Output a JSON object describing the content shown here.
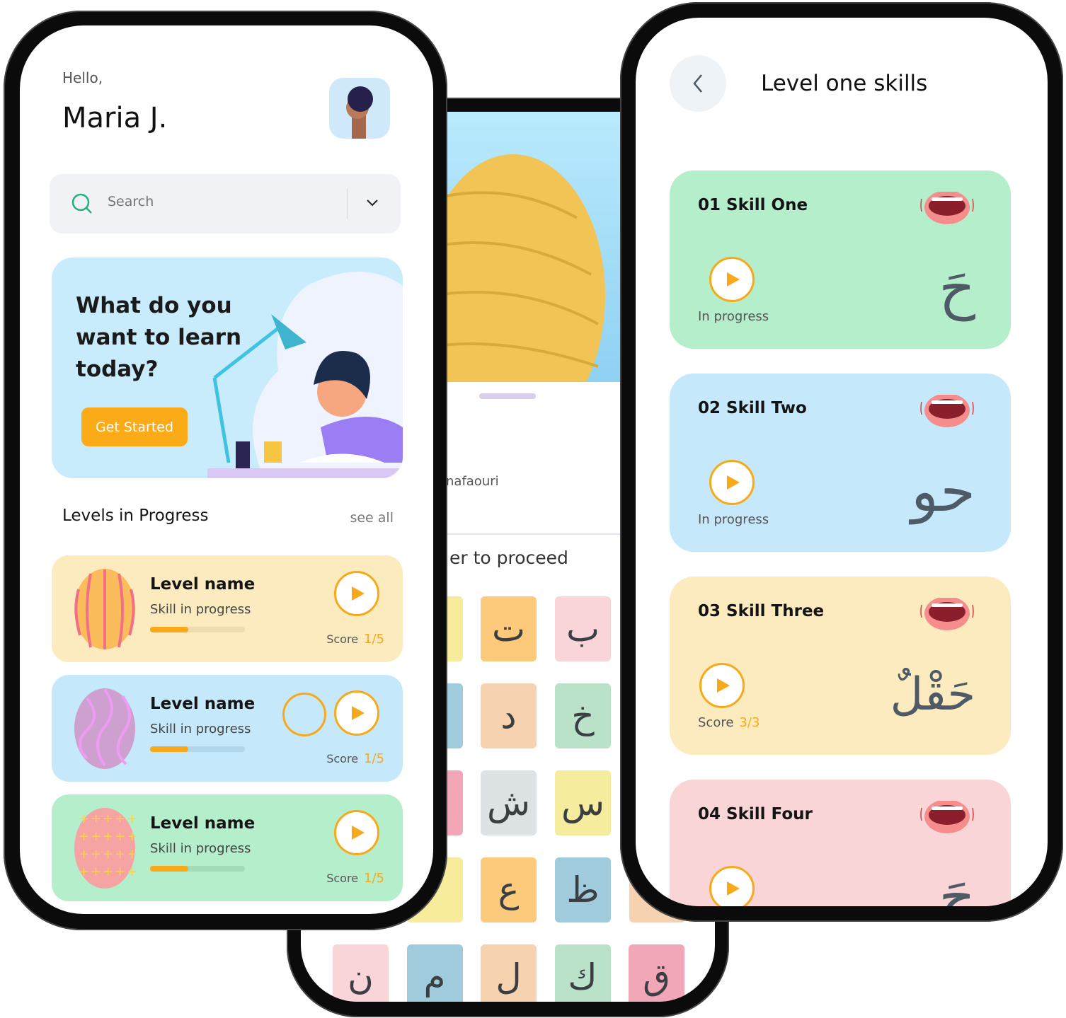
{
  "colors": {
    "accent": "#f8a91a",
    "text_dark": "#141414"
  },
  "middle": {
    "user_fragment": "nafaouri",
    "prompt_fragment": "er to proceed",
    "letters": [
      {
        "char": "",
        "color": "#f7eb9c"
      },
      {
        "char": "ت",
        "color": "#fdc97a"
      },
      {
        "char": "ب",
        "color": "#f9d5d9"
      },
      {
        "char": "",
        "color": "#9fcbdc"
      },
      {
        "char": "د",
        "color": "#f7d2b0"
      },
      {
        "char": "خ",
        "color": "#b9e2c8"
      },
      {
        "char": "",
        "color": "#f2a7b8"
      },
      {
        "char": "ش",
        "color": "#dde3e5"
      },
      {
        "char": "س",
        "color": "#f6ec9d"
      },
      {
        "char": "",
        "color": "#f7eb9c"
      },
      {
        "char": "ع",
        "color": "#fdc97a"
      },
      {
        "char": "ظ",
        "color": "#9fcbdc"
      }
    ],
    "bottom_row": [
      {
        "char": "ن",
        "color": "#f9d5d9"
      },
      {
        "char": "م",
        "color": "#9fcbdc"
      },
      {
        "char": "ل",
        "color": "#f7d2b0"
      },
      {
        "char": "ك",
        "color": "#b9e2c8"
      },
      {
        "char": "ق",
        "color": "#f2a7b8"
      }
    ]
  },
  "home": {
    "greeting": "Hello,",
    "user_name": "Maria J.",
    "search": {
      "placeholder": "Search",
      "icon": "search-icon"
    },
    "banner": {
      "line1": "What do you",
      "line2": "want to learn",
      "line3": "today?",
      "cta": "Get Started"
    },
    "levels_title": "Levels in Progress",
    "see_all": "see all",
    "levels": [
      {
        "name": "Level name",
        "subtitle": "Skill in progress",
        "progress": 0.4,
        "score_label": "Score",
        "score": "1/5",
        "color": "#fdebc0",
        "track": "#ecdcb0"
      },
      {
        "name": "Level name",
        "subtitle": "Skill in progress",
        "progress": 0.4,
        "score_label": "Score",
        "score": "1/5",
        "color": "#c5e8fb",
        "track": "#b2d6ea"
      },
      {
        "name": "Level name",
        "subtitle": "Skill in progress",
        "progress": 0.4,
        "score_label": "Score",
        "score": "1/5",
        "color": "#b5eecb",
        "track": "#a3dbb9"
      }
    ]
  },
  "skills": {
    "title": "Level one skills",
    "items": [
      {
        "title": "01 Skill One",
        "status": "In progress",
        "letter": "حَ",
        "color": "#b5eecb"
      },
      {
        "title": "02 Skill Two",
        "status": "In progress",
        "letter": "حو",
        "color": "#c5e8fb"
      },
      {
        "title": "03 Skill Three",
        "status": "Score",
        "score": "3/3",
        "letter": "حَقْلٌ",
        "color": "#fdebc0"
      },
      {
        "title": "04 Skill Four",
        "status": "",
        "letter": "حَ",
        "color": "#fad5d8"
      }
    ]
  }
}
